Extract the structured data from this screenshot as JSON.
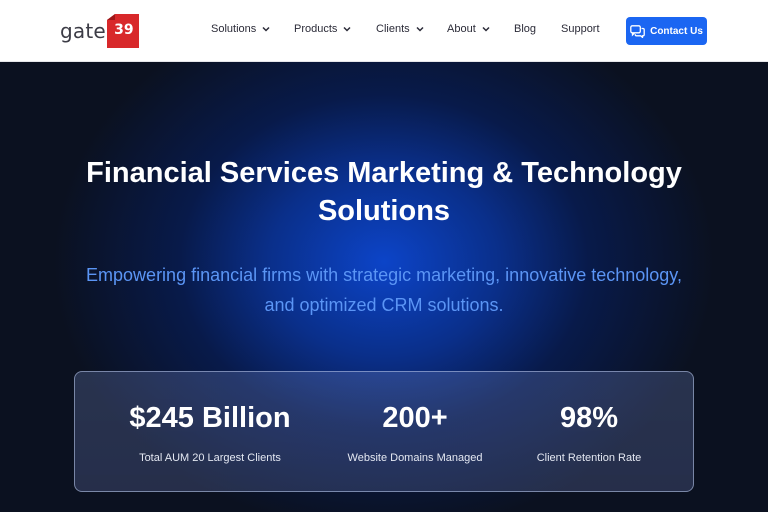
{
  "brand": {
    "name": "gate",
    "number": "39",
    "badge_color": "#d8282a"
  },
  "nav": {
    "items": [
      {
        "label": "Solutions",
        "has_dropdown": true
      },
      {
        "label": "Products",
        "has_dropdown": true
      },
      {
        "label": "Clients",
        "has_dropdown": true
      },
      {
        "label": "About",
        "has_dropdown": true
      },
      {
        "label": "Blog",
        "has_dropdown": false
      },
      {
        "label": "Support",
        "has_dropdown": false
      }
    ],
    "cta": {
      "label": "Contact Us",
      "icon": "chat-bubbles-icon",
      "color": "#1b66f2"
    }
  },
  "hero": {
    "title_line1": "Financial Services Marketing & Technology",
    "title_line2": "Solutions",
    "subtitle_line1": "Empowering financial firms with strategic marketing, innovative technology,",
    "subtitle_line2": "and optimized CRM solutions.",
    "accent_color": "#5b95f5"
  },
  "stats": [
    {
      "value": "$245 Billion",
      "label": "Total AUM 20 Largest Clients"
    },
    {
      "value": "200+",
      "label": "Website Domains Managed"
    },
    {
      "value": "98%",
      "label": "Client Retention Rate"
    }
  ]
}
